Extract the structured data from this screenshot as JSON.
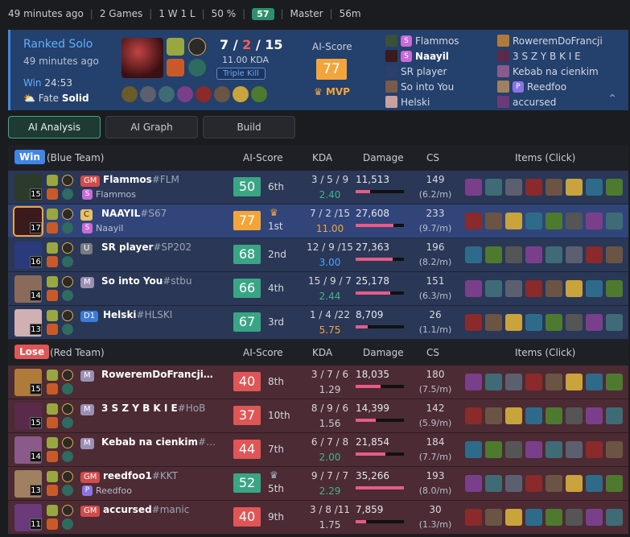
{
  "topbar": {
    "ago": "49 minutes ago",
    "games": "2 Games",
    "record": "1 W 1 L",
    "winrate": "50 %",
    "badge": "57",
    "tier": "Master",
    "duration": "56m"
  },
  "summary": {
    "queue": "Ranked Solo",
    "ago": "49 minutes ago",
    "result": "Win",
    "time": "24:53",
    "fate": "Fate",
    "fate_val": "Solid",
    "kda_k": "7",
    "kda_d": "2",
    "kda_a": "15",
    "kda_ratio": "11.00 KDA",
    "multikill": "Triple Kill",
    "ai_label": "AI-Score",
    "ai_score": "77",
    "mvp": "MVP",
    "blue_players": [
      {
        "name": "Flammos",
        "badge": "S"
      },
      {
        "name": "Naayil",
        "badge": "S"
      },
      {
        "name": "SR player",
        "badge": ""
      },
      {
        "name": "So into You",
        "badge": ""
      },
      {
        "name": "Helski",
        "badge": ""
      }
    ],
    "red_players": [
      {
        "name": "RoweremDoFrancji",
        "badge": ""
      },
      {
        "name": "3 S Z Y B K I E",
        "badge": ""
      },
      {
        "name": "Kebab na cienkim",
        "badge": ""
      },
      {
        "name": "Reedfoo",
        "badge": "P"
      },
      {
        "name": "accursed",
        "badge": ""
      }
    ]
  },
  "tabs": [
    {
      "label": "AI Analysis"
    },
    {
      "label": "AI Graph"
    },
    {
      "label": "Build"
    }
  ],
  "blue": {
    "result": "Win",
    "team": "(Blue Team)",
    "h_ai": "AI-Score",
    "h_kda": "KDA",
    "h_dmg": "Damage",
    "h_cs": "CS",
    "h_items": "Items (Click)",
    "rows": [
      {
        "level": "15",
        "rank": "GM",
        "name": "Flammos",
        "tag": "#FLM",
        "sub": "Flammos",
        "sub_badge": "S",
        "score": "50",
        "place": "6th",
        "kda": "3 / 5 / 9",
        "ratio": "2.40",
        "damage": "11,513",
        "dmg_pct": 30,
        "cs": "149",
        "csm": "(6.2/m)"
      },
      {
        "level": "17",
        "rank": "C",
        "name": "NAAYIL",
        "tag": "#S67",
        "sub": "Naayil",
        "sub_badge": "S",
        "score": "77",
        "place": "1st",
        "kda": "7 / 2 /15",
        "ratio": "11.00",
        "damage": "27,608",
        "dmg_pct": 78,
        "cs": "233",
        "csm": "(9.7/m)"
      },
      {
        "level": "16",
        "rank": "U",
        "name": "SR player",
        "tag": "#SP202",
        "sub": "",
        "sub_badge": "",
        "score": "68",
        "place": "2nd",
        "kda": "12 / 9 /15",
        "ratio": "3.00",
        "damage": "27,363",
        "dmg_pct": 77,
        "cs": "196",
        "csm": "(8.2/m)"
      },
      {
        "level": "14",
        "rank": "M",
        "name": "So into You",
        "tag": "#stbu",
        "sub": "",
        "sub_badge": "",
        "score": "66",
        "place": "4th",
        "kda": "15 / 9 / 7",
        "ratio": "2.44",
        "damage": "25,178",
        "dmg_pct": 71,
        "cs": "151",
        "csm": "(6.3/m)"
      },
      {
        "level": "13",
        "rank": "D1",
        "name": "Helski",
        "tag": "#HLSKI",
        "sub": "",
        "sub_badge": "",
        "score": "67",
        "place": "3rd",
        "kda": "1 / 4 /22",
        "ratio": "5.75",
        "damage": "8,709",
        "dmg_pct": 25,
        "cs": "26",
        "csm": "(1.1/m)"
      }
    ]
  },
  "red": {
    "result": "Lose",
    "team": "(Red Team)",
    "h_ai": "AI-Score",
    "h_kda": "KDA",
    "h_dmg": "Damage",
    "h_cs": "CS",
    "h_items": "Items (Click)",
    "rows": [
      {
        "level": "15",
        "rank": "M",
        "name": "RoweremDoFrancji…",
        "tag": "",
        "sub": "",
        "sub_badge": "",
        "score": "40",
        "place": "8th",
        "kda": "3 / 7 / 6",
        "ratio": "1.29",
        "damage": "18,035",
        "dmg_pct": 51,
        "cs": "180",
        "csm": "(7.5/m)"
      },
      {
        "level": "15",
        "rank": "M",
        "name": "3 S Z Y B K I E",
        "tag": "#HoB",
        "sub": "",
        "sub_badge": "",
        "score": "37",
        "place": "10th",
        "kda": "8 / 9 / 6",
        "ratio": "1.56",
        "damage": "14,399",
        "dmg_pct": 41,
        "cs": "142",
        "csm": "(5.9/m)"
      },
      {
        "level": "14",
        "rank": "M",
        "name": "Kebab na cienkim",
        "tag": "#…",
        "sub": "",
        "sub_badge": "",
        "score": "44",
        "place": "7th",
        "kda": "6 / 7 / 8",
        "ratio": "2.00",
        "damage": "21,854",
        "dmg_pct": 62,
        "cs": "184",
        "csm": "(7.7/m)"
      },
      {
        "level": "13",
        "rank": "GM",
        "name": "reedfoo1",
        "tag": "#KKT",
        "sub": "Reedfoo",
        "sub_badge": "P",
        "score": "52",
        "place": "5th",
        "kda": "9 / 7 / 7",
        "ratio": "2.29",
        "damage": "35,266",
        "dmg_pct": 100,
        "cs": "193",
        "csm": "(8.0/m)"
      },
      {
        "level": "11",
        "rank": "GM",
        "name": "accursed",
        "tag": "#manic",
        "sub": "",
        "sub_badge": "",
        "score": "40",
        "place": "9th",
        "kda": "3 / 8 /11",
        "ratio": "1.75",
        "damage": "7,859",
        "dmg_pct": 22,
        "cs": "30",
        "csm": "(1.3/m)"
      }
    ]
  }
}
